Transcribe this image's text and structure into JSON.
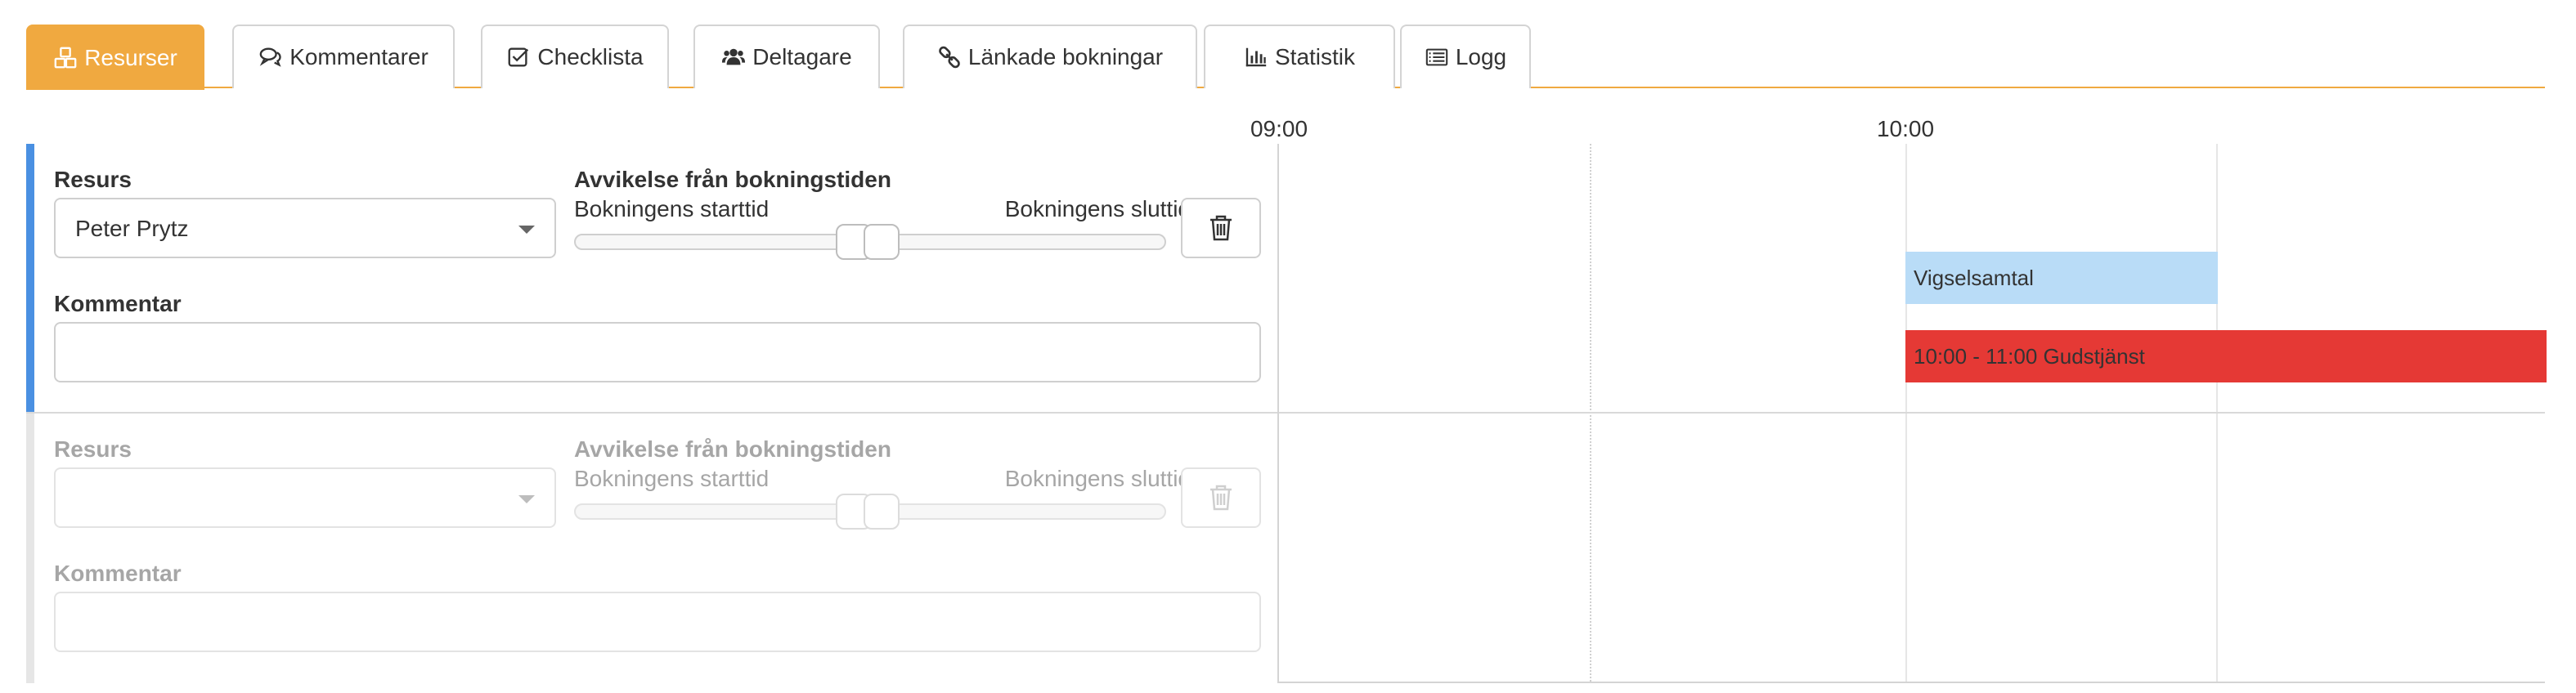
{
  "tabs": [
    {
      "label": "Resurser",
      "icon": "cubes-icon",
      "active": true
    },
    {
      "label": "Kommentarer",
      "icon": "comments-icon",
      "active": false
    },
    {
      "label": "Checklista",
      "icon": "checkbox-icon",
      "active": false
    },
    {
      "label": "Deltagare",
      "icon": "users-icon",
      "active": false
    },
    {
      "label": "Länkade bokningar",
      "icon": "link-icon",
      "active": false
    },
    {
      "label": "Statistik",
      "icon": "bar-chart-icon",
      "active": false
    },
    {
      "label": "Logg",
      "icon": "list-icon",
      "active": false
    }
  ],
  "colors": {
    "accent": "#f0a940",
    "active_row_bar": "#4a90e2",
    "inactive_row_bar": "#e6e6e6",
    "event_blue": "#b9dcf7",
    "event_red": "#e53935"
  },
  "resources": [
    {
      "resource_label": "Resurs",
      "resource_value": "Peter Prytz",
      "deviation_label": "Avvikelse från bokningstiden",
      "start_label": "Bokningens starttid",
      "end_label": "Bokningens sluttid",
      "comment_label": "Kommentar",
      "comment_value": "",
      "enabled": true
    },
    {
      "resource_label": "Resurs",
      "resource_value": "",
      "deviation_label": "Avvikelse från bokningstiden",
      "start_label": "Bokningens starttid",
      "end_label": "Bokningens sluttid",
      "comment_label": "Kommentar",
      "comment_value": "",
      "enabled": false
    }
  ],
  "timeline": {
    "hours": [
      "09:00",
      "10:00"
    ],
    "events": [
      {
        "label": "Vigselsamtal",
        "color": "blue"
      },
      {
        "label": "10:00 - 11:00 Gudstjänst",
        "color": "red"
      }
    ]
  }
}
